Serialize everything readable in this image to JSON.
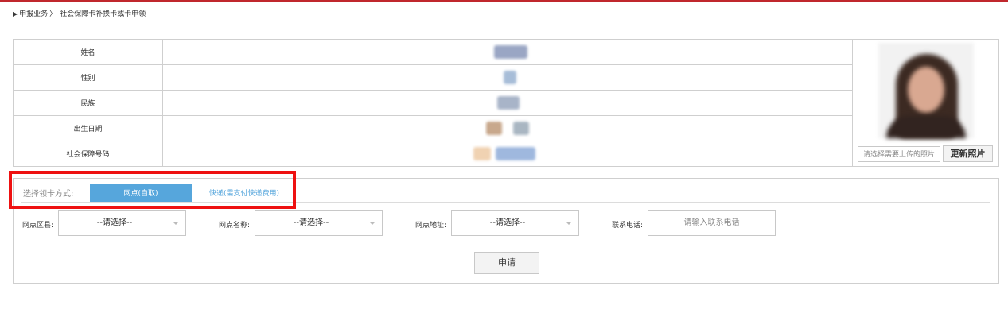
{
  "breadcrumb": {
    "arrow": "▶",
    "section": "申报业务",
    "separator": "〉",
    "current": "社会保障卡补换卡或卡申领"
  },
  "info_table": {
    "rows": [
      {
        "label": "姓名"
      },
      {
        "label": "性别"
      },
      {
        "label": "民族"
      },
      {
        "label": "出生日期"
      },
      {
        "label": "社会保障号码"
      }
    ]
  },
  "photo": {
    "upload_placeholder": "请选择需要上传的照片",
    "update_label": "更新照片"
  },
  "card_method": {
    "label": "选择领卡方式:",
    "options": [
      {
        "label": "网点(自取)",
        "selected": true
      },
      {
        "label": "快递(需支付快递费用)",
        "selected": false
      }
    ]
  },
  "fields": {
    "district": {
      "label": "网点区县:",
      "value": "--请选择--"
    },
    "outlet_name": {
      "label": "网点名称:",
      "value": "--请选择--"
    },
    "outlet_address": {
      "label": "网点地址:",
      "value": "--请选择--"
    },
    "phone": {
      "label": "联系电话:",
      "placeholder": "请输入联系电话"
    }
  },
  "actions": {
    "apply_label": "申请"
  },
  "colors": {
    "accent": "#56a6dc",
    "top_bar": "#c0272d",
    "highlight": "#ee1111"
  }
}
